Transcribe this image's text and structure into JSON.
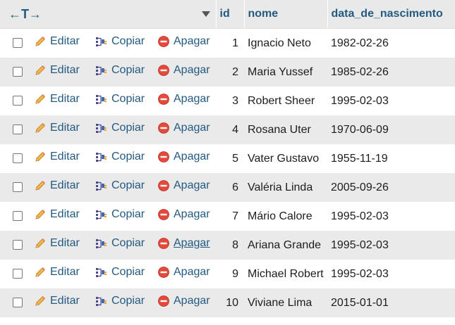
{
  "columns": {
    "id": "id",
    "nome": "nome",
    "data": "data_de_nascimento"
  },
  "actions": {
    "edit": "Editar",
    "copy": "Copiar",
    "delete": "Apagar"
  },
  "rows": [
    {
      "id": "1",
      "nome": "Ignacio Neto",
      "data": "1982-02-26"
    },
    {
      "id": "2",
      "nome": "Maria Yussef",
      "data": "1985-02-26"
    },
    {
      "id": "3",
      "nome": "Robert Sheer",
      "data": "1995-02-03"
    },
    {
      "id": "4",
      "nome": "Rosana Uter",
      "data": "1970-06-09"
    },
    {
      "id": "5",
      "nome": "Vater Gustavo",
      "data": "1955-11-19"
    },
    {
      "id": "6",
      "nome": "Valéria Linda",
      "data": "2005-09-26"
    },
    {
      "id": "7",
      "nome": "Mário Calore",
      "data": "1995-02-03"
    },
    {
      "id": "8",
      "nome": "Ariana Grande",
      "data": "1995-02-03"
    },
    {
      "id": "9",
      "nome": "Michael Robert",
      "data": "1995-02-03"
    },
    {
      "id": "10",
      "nome": "Viviane Lima",
      "data": "2015-01-01"
    }
  ],
  "icons": {
    "edit": "pencil-icon",
    "copy": "copy-icon",
    "delete": "delete-icon",
    "col_arrows": "column-resize-arrows-icon",
    "sort": "sort-triangle-icon"
  },
  "colors": {
    "link": "#235a81",
    "header_bg": "#e9e9e9",
    "row_even": "#eaeaea",
    "delete_red": "#e34a3b",
    "pencil": "#e6a43a"
  }
}
